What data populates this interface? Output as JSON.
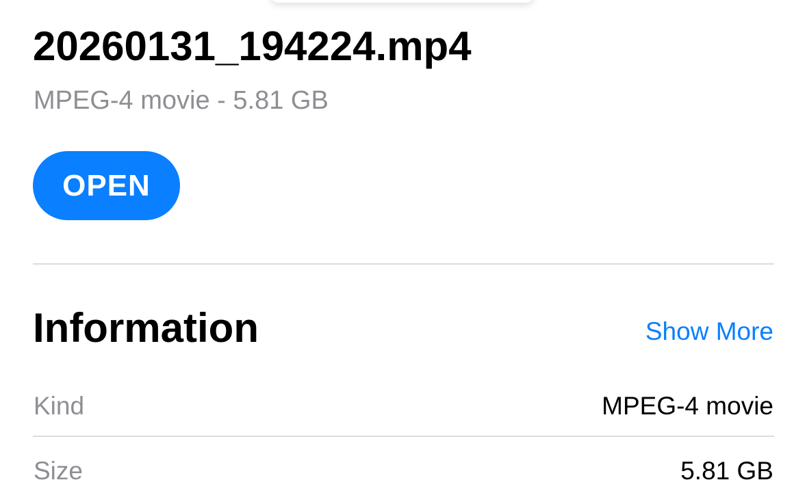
{
  "file": {
    "name": "20260131_194224.mp4",
    "subtitle": "MPEG-4 movie - 5.81 GB",
    "open_label": "OPEN"
  },
  "information": {
    "title": "Information",
    "show_more_label": "Show More",
    "rows": [
      {
        "label": "Kind",
        "value": "MPEG-4 movie"
      },
      {
        "label": "Size",
        "value": "5.81 GB"
      }
    ]
  },
  "colors": {
    "accent": "#0a7fff",
    "secondary_text": "#8e8e93",
    "divider": "#dcdcdf"
  }
}
